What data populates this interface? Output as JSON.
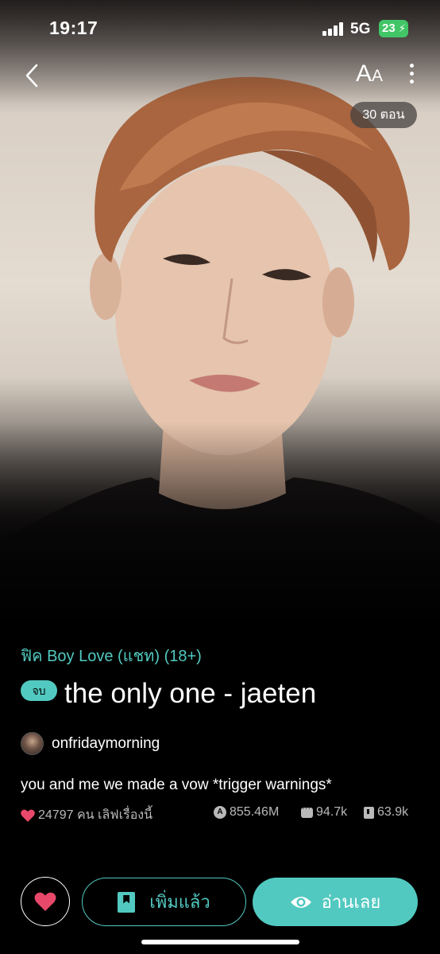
{
  "status_bar": {
    "time": "19:17",
    "network": "5G",
    "battery": "23"
  },
  "header": {
    "font_size_label_large": "A",
    "font_size_label_small": "A",
    "episodes": "30 ตอน"
  },
  "story": {
    "genre": "ฟิค Boy Love (แชท) (18+)",
    "status_badge": "จบ",
    "title": "the only one - jaeten",
    "author": "onfridaymorning",
    "tagline": "you and me we made a vow *trigger warnings*",
    "likes": "24797 คน เลิฟเรื่องนี้",
    "reads": "855.46M",
    "comments": "94.7k",
    "saves": "63.9k"
  },
  "actions": {
    "library_label": "เพิ่มแล้ว",
    "read_label": "อ่านเลย"
  },
  "colors": {
    "accent": "#52c9c0",
    "like": "#e8496a",
    "battery": "#42c567"
  },
  "icons": [
    "back-chevron-icon",
    "font-size-icon",
    "more-vertical-icon",
    "heart-icon",
    "read-count-icon",
    "comment-icon",
    "bookmark-icon",
    "eye-icon"
  ]
}
